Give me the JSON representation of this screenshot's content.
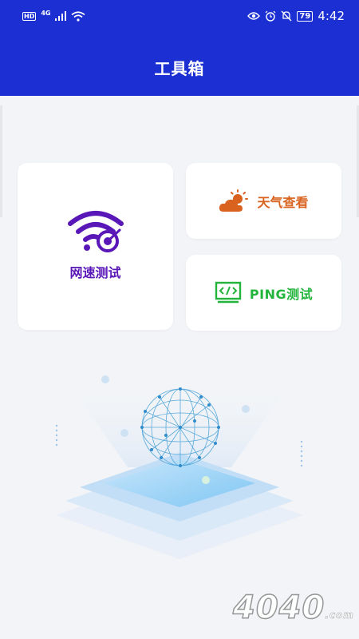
{
  "status_bar": {
    "left_badge": "HD",
    "network": "4G",
    "battery": "79",
    "time": "4:42"
  },
  "header": {
    "title": "工具箱"
  },
  "tools": {
    "speed_test": {
      "label": "网速测试",
      "icon": "wifi-target-icon",
      "color": "#5a17b8"
    },
    "weather": {
      "label": "天气查看",
      "icon": "sun-cloud-icon",
      "color": "#d9621e"
    },
    "ping": {
      "label": "PING测试",
      "icon": "code-monitor-icon",
      "color": "#23b43b"
    }
  },
  "watermark": {
    "text": "4040",
    "suffix": ".com"
  },
  "colors": {
    "appbar": "#1b2fd3",
    "background": "#f2f4f7"
  }
}
